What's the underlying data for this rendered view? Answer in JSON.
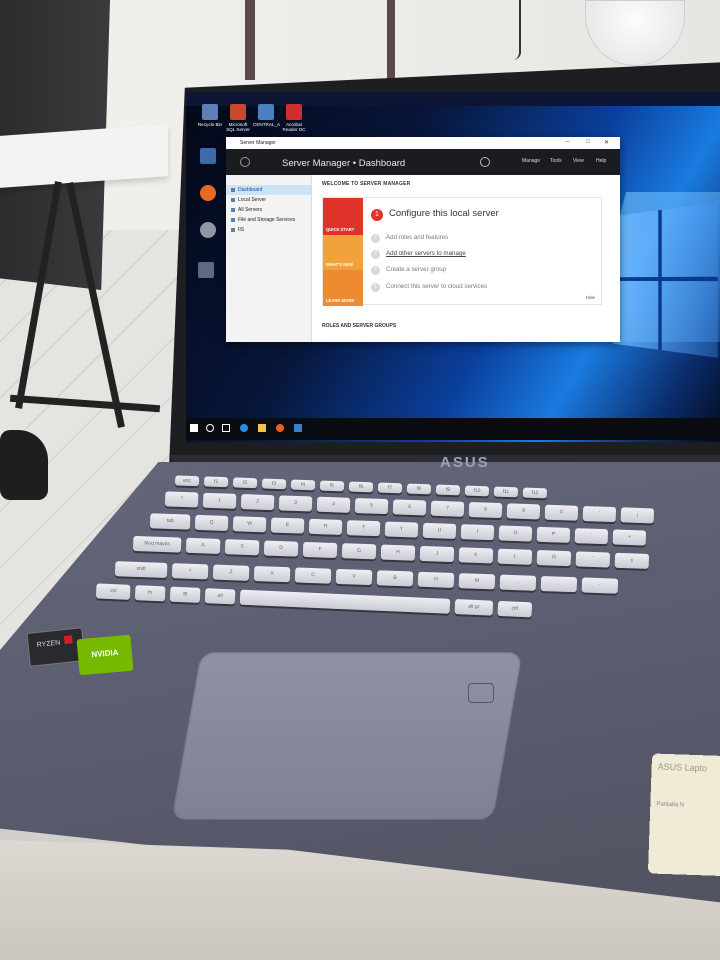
{
  "scene": {
    "laptop_brand": "ASUS"
  },
  "desktop_icons": [
    {
      "label": "Recycle Bin"
    },
    {
      "label": "Microsoft SQL Server"
    },
    {
      "label": "CENTRAL_A"
    },
    {
      "label": "Acrobat Reader DC"
    }
  ],
  "server_manager": {
    "window_title": "Server Manager",
    "breadcrumb": "Server Manager • Dashboard",
    "menu": [
      "Manage",
      "Tools",
      "View",
      "Help"
    ],
    "nav": [
      {
        "label": "Dashboard",
        "active": true
      },
      {
        "label": "Local Server"
      },
      {
        "label": "All Servers"
      },
      {
        "label": "File and Storage Services"
      },
      {
        "label": "IIS"
      }
    ],
    "welcome_heading": "WELCOME TO SERVER MANAGER",
    "blocks": [
      "QUICK START",
      "WHAT'S NEW",
      "LEARN MORE"
    ],
    "steps": [
      {
        "num": "1",
        "text": "Configure this local server"
      },
      {
        "num": "2",
        "text": "Add roles and features"
      },
      {
        "num": "3",
        "text": "Add other servers to manage"
      },
      {
        "num": "4",
        "text": "Create a server group"
      },
      {
        "num": "5",
        "text": "Connect this server to cloud services"
      }
    ],
    "hide_label": "Hide",
    "roles_heading": "ROLES AND SERVER GROUPS"
  },
  "keyboard": {
    "row1": [
      "esc",
      "f1",
      "f2",
      "f3",
      "f4",
      "f5",
      "f6",
      "f7",
      "f8",
      "f9",
      "f10",
      "f11",
      "f12"
    ],
    "row2": [
      "º",
      "1",
      "2",
      "3",
      "4",
      "5",
      "6",
      "7",
      "8",
      "9",
      "0",
      "'",
      "¡"
    ],
    "row3": [
      "tab",
      "Q",
      "W",
      "E",
      "R",
      "T",
      "Y",
      "U",
      "I",
      "O",
      "P",
      "`",
      "+"
    ],
    "row4": [
      "bloq mayús",
      "A",
      "S",
      "D",
      "F",
      "G",
      "H",
      "J",
      "K",
      "L",
      "Ñ",
      "´",
      "ç"
    ],
    "row5": [
      "shift",
      "<",
      "Z",
      "X",
      "C",
      "V",
      "B",
      "N",
      "M",
      ",",
      ".",
      "-"
    ],
    "row6": [
      "ctrl",
      "fn",
      "⊞",
      "alt",
      "",
      "alt gr",
      "ctrl"
    ]
  },
  "stickers": {
    "nvidia": "NVIDIA",
    "ryzen": "RYZEN",
    "card_title": "ASUS Lapto",
    "card_sub": "Pantalla N"
  }
}
